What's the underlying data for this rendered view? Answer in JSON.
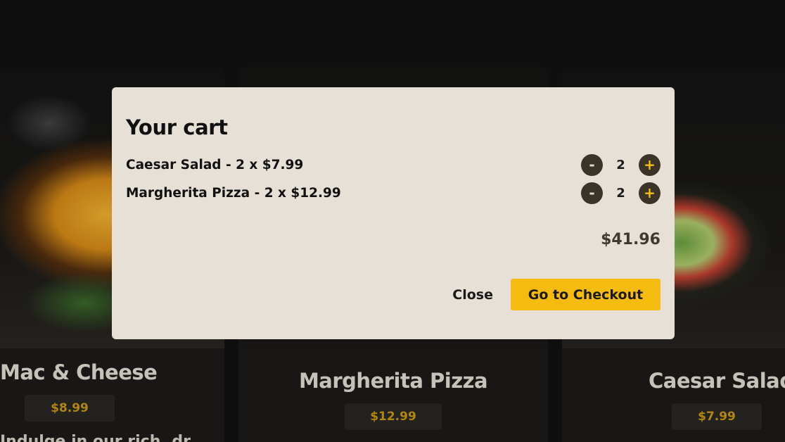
{
  "menu": {
    "items": [
      {
        "name": "Mac & Cheese",
        "price": "$8.99",
        "description": "Indulge in our rich, dr"
      },
      {
        "name": "Margherita Pizza",
        "price": "$12.99"
      },
      {
        "name": "Caesar Salad",
        "price": "$7.99"
      }
    ]
  },
  "cart": {
    "title": "Your cart",
    "items": [
      {
        "label": "Caesar Salad - 2 x $7.99",
        "minus": "-",
        "quantity": "2",
        "plus": "+"
      },
      {
        "label": "Margherita Pizza - 2 x $12.99",
        "minus": "-",
        "quantity": "2",
        "plus": "+"
      }
    ],
    "total": "$41.96",
    "close_label": "Close",
    "checkout_label": "Go to Checkout"
  },
  "colors": {
    "accent": "#f5bc0f",
    "modal_bg": "#e6e0d6",
    "page_bg": "#121212"
  }
}
